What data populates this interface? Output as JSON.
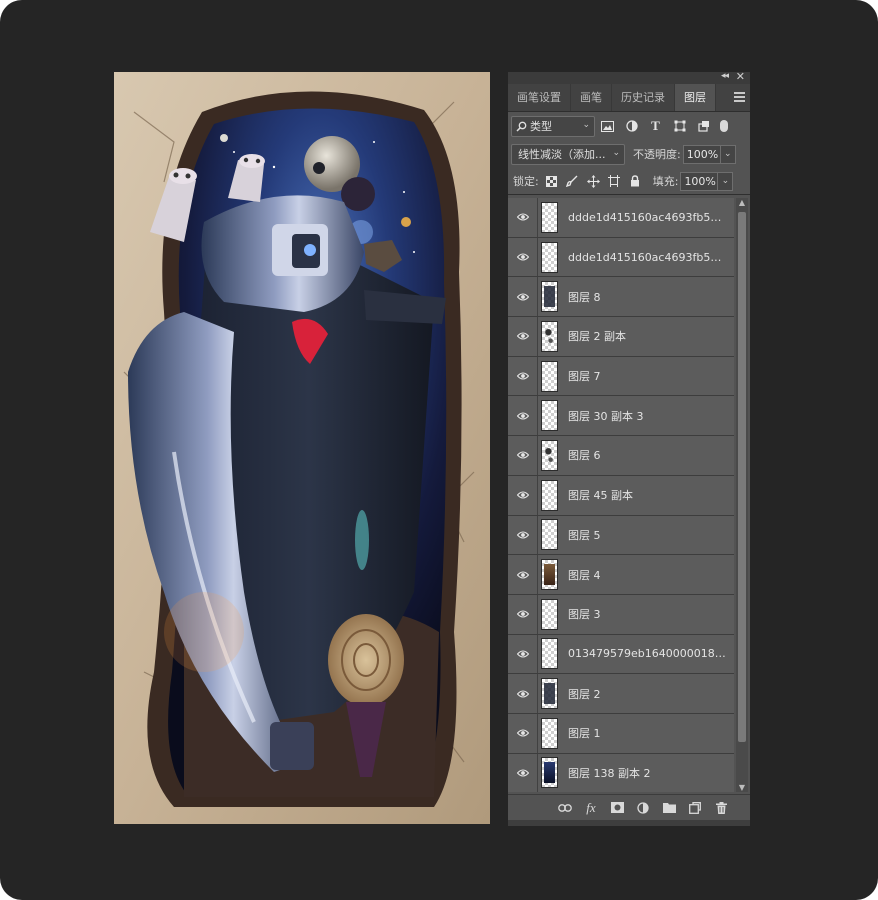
{
  "panel": {
    "tabs": [
      {
        "label": "画笔设置"
      },
      {
        "label": "画笔"
      },
      {
        "label": "历史记录"
      },
      {
        "label": "图层"
      }
    ],
    "active_tab": "图层",
    "filter": {
      "label": "类型"
    },
    "blend_mode": "线性减淡（添加...",
    "opacity": {
      "label": "不透明度:",
      "value": "100%"
    },
    "lock_label": "锁定:",
    "fill": {
      "label": "填充:",
      "value": "100%"
    },
    "layers": [
      {
        "name": "ddde1d415160ac4693fb57d3...",
        "thumb": "blank"
      },
      {
        "name": "ddde1d415160ac4693fb57d3...",
        "thumb": "blank"
      },
      {
        "name": "图层 8",
        "thumb": "dark"
      },
      {
        "name": "图层 2 副本",
        "thumb": "speck"
      },
      {
        "name": "图层 7",
        "thumb": "blank"
      },
      {
        "name": "图层 30 副本 3",
        "thumb": "blank"
      },
      {
        "name": "图层 6",
        "thumb": "speck"
      },
      {
        "name": "图层 45 副本",
        "thumb": "blank"
      },
      {
        "name": "图层 5",
        "thumb": "blank"
      },
      {
        "name": "图层 4",
        "thumb": "brown"
      },
      {
        "name": "图层 3",
        "thumb": "blank"
      },
      {
        "name": "013479579eb1640000018c1b...",
        "thumb": "blank"
      },
      {
        "name": "图层 2",
        "thumb": "dark"
      },
      {
        "name": "图层 1",
        "thumb": "blank"
      },
      {
        "name": "图层 138 副本 2",
        "thumb": "space"
      }
    ],
    "colors": {
      "panel_bg": "#535353",
      "row_bg": "#5c5c5c",
      "tab_bar": "#424242"
    }
  }
}
